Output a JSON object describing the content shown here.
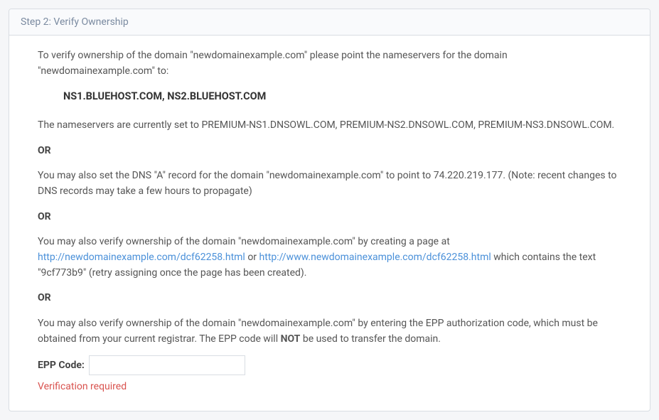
{
  "header": {
    "title": "Step 2: Verify Ownership"
  },
  "body": {
    "intro": "To verify ownership of the domain \"newdomainexample.com\" please point the nameservers for the domain \"newdomainexample.com\" to:",
    "nameservers": "NS1.BLUEHOST.COM, NS2.BLUEHOST.COM",
    "current_ns": "The nameservers are currently set to PREMIUM-NS1.DNSOWL.COM, PREMIUM-NS2.DNSOWL.COM, PREMIUM-NS3.DNSOWL.COM.",
    "or1": "OR",
    "a_record": "You may also set the DNS \"A\" record for the domain \"newdomainexample.com\" to point to 74.220.219.177. (Note: recent changes to DNS records may take a few hours to propagate)",
    "or2": "OR",
    "verify_page_pre": "You may also verify ownership of the domain \"newdomainexample.com\" by creating a page at ",
    "verify_link1": "http://newdomainexample.com/dcf62258.html",
    "verify_mid": " or ",
    "verify_link2": "http://www.newdomainexample.com/dcf62258.html",
    "verify_page_post": " which contains the text \"9cf773b9\" (retry assigning once the page has been created).",
    "or3": "OR",
    "epp_text_pre": "You may also verify ownership of the domain \"newdomainexample.com\" by entering the EPP authorization code, which must be obtained from your current registrar. The EPP code will ",
    "epp_not": "NOT",
    "epp_text_post": " be used to transfer the domain.",
    "epp_label": "EPP Code:",
    "epp_value": "",
    "error": "Verification required"
  }
}
